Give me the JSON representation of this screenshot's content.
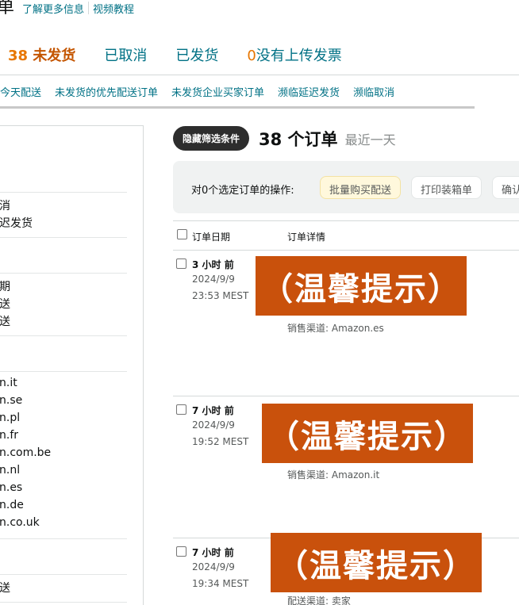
{
  "header": {
    "title_char": "单",
    "links": [
      "了解更多信息",
      "视频教程"
    ]
  },
  "status_tabs": [
    {
      "num": "38",
      "label": "未发货",
      "active": true
    },
    {
      "num": "",
      "label": "已取消",
      "active": false
    },
    {
      "num": "",
      "label": "已发货",
      "active": false
    },
    {
      "num": "0",
      "label": "没有上传发票",
      "active": false
    }
  ],
  "sub_tabs": [
    "今天配送",
    "未发货的优先配送订单",
    "未发货企业买家订单",
    "濒临延迟发货",
    "濒临取消"
  ],
  "sidebar": {
    "items": [
      "消",
      "迟发货",
      "期",
      "送",
      "送",
      "n.it",
      "n.se",
      "n.pl",
      "n.fr",
      "n.com.be",
      "n.nl",
      "n.es",
      "n.de",
      "n.co.uk",
      "送"
    ]
  },
  "main": {
    "filter_toggle": "隐藏筛选条件",
    "order_count": "38 个订单",
    "date_range": "最近一天",
    "bulk_label": "对0个选定订单的操作:",
    "bulk_buttons": [
      "批量购买配送",
      "打印装箱单",
      "确认"
    ],
    "columns": [
      "订单日期",
      "订单详情"
    ]
  },
  "orders": [
    {
      "ago": "3 小时 前",
      "date": "2024/9/9",
      "time": "23:53 MEST",
      "channel": "销售渠道: Amazon.es",
      "notice": "（温馨提示）"
    },
    {
      "ago": "7 小时 前",
      "date": "2024/9/9",
      "time": "19:52 MEST",
      "channel": "销售渠道: Amazon.it",
      "notice": "（温馨提示）"
    },
    {
      "ago": "7 小时 前",
      "date": "2024/9/9",
      "time": "19:34 MEST",
      "channel": "配送渠道: 卖家",
      "notice": "（温馨提示）"
    }
  ],
  "colors": {
    "link": "#007185",
    "active_tab": "#c45500",
    "count_accent": "#e77600",
    "notice_bg": "#c9510c"
  }
}
